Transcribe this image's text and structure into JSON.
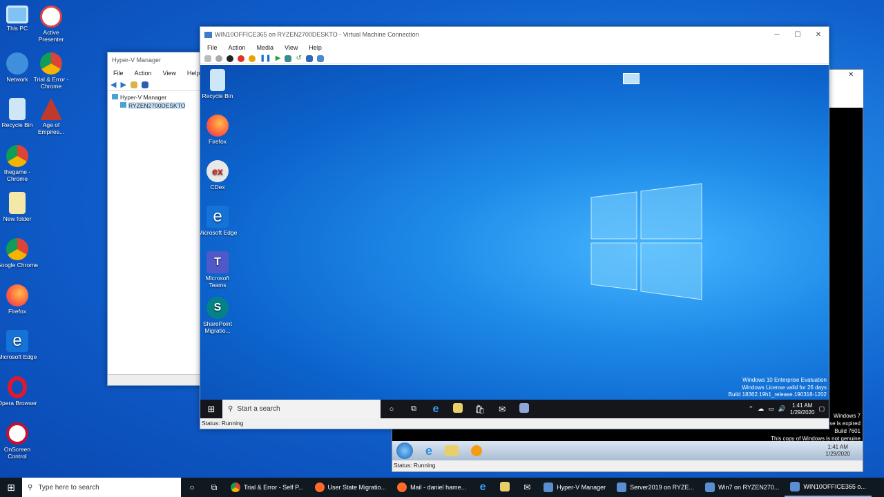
{
  "desktop": {
    "icons": [
      "This PC",
      "Active Presenter",
      "Network",
      "Trial & Error - Chrome",
      "Recycle Bin",
      "Age of Empires...",
      "thegame - Chrome",
      "New folder",
      "Google Chrome",
      "Firefox",
      "Microsoft Edge",
      "Opera Browser",
      "OnScreen Control"
    ]
  },
  "hyperv": {
    "title": "Hyper-V Manager",
    "menu": [
      "File",
      "Action",
      "View",
      "Help"
    ],
    "tree_root": "Hyper-V Manager",
    "tree_child": "RYZEN2700DESKTO"
  },
  "vmc": {
    "title": "WIN10OFFICE365 on RYZEN2700DESKTO - Virtual Machine Connection",
    "menu": [
      "File",
      "Action",
      "Media",
      "View",
      "Help"
    ],
    "status": "Status: Running",
    "guest_icons": [
      "Recycle Bin",
      "Firefox",
      "CDex",
      "Microsoft Edge",
      "Microsoft Teams",
      "SharePoint Migratio..."
    ],
    "watermark": [
      "Windows 10 Enterprise Evaluation",
      "Windows License valid for 26 days",
      "Build 18362.19h1_release.190318-1202"
    ],
    "search": "Start a search",
    "time": "1:41 AM",
    "date": "1/29/2020"
  },
  "win7": {
    "wm": [
      "Windows 7",
      "nse is expired",
      "Build 7601",
      "This copy of Windows is not genuine"
    ],
    "time": "1:41 AM",
    "date": "1/29/2020",
    "status": "Status: Running"
  },
  "taskbar": {
    "search": "Type here to search",
    "items": [
      "Trial & Error - Self P...",
      "User State Migratio...",
      "Mail - daniel hame...",
      "Hyper-V Manager",
      "Server2019 on RYZE...",
      "Win7 on RYZEN270...",
      "WIN10OFFICE365 o..."
    ]
  }
}
